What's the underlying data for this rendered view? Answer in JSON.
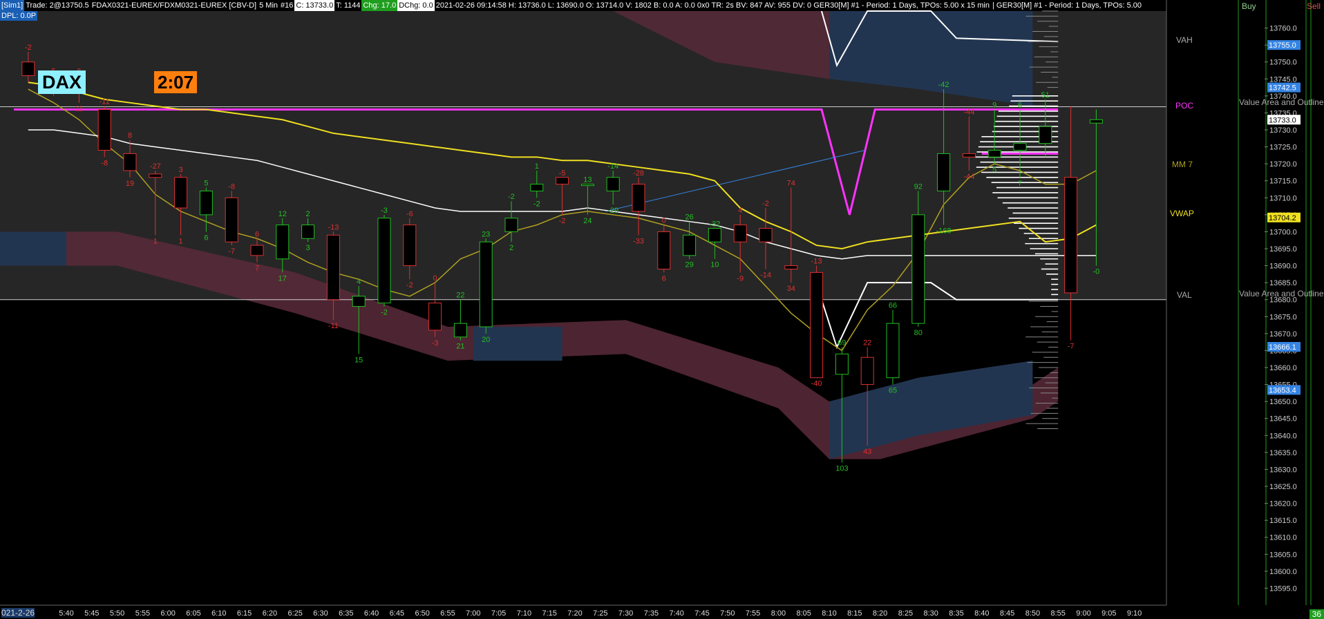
{
  "header": {
    "sim": "[Sim1]",
    "trade": "Trade: 2@13750.5",
    "instrument": "FDAX0321-EUREX/FDXM0321-EUREX [CBV-D]",
    "interval": "5 Min",
    "bar_no": "#16",
    "close": "C: 13733.0",
    "ticks": "T: 1144",
    "chg": "Chg: 17.0",
    "dchg": "DChg: 0.0",
    "stats": "2021-02-26 09:14:58 H: 13736.0 L: 13690.0 O: 13714.0 V: 1802 B: 0.0 A: 0.0 0x0 TR: 2s BV: 847 AV: 955 DV: 0 GER30[M] #1 - Period: 1 Days, TPOs: 5.00 x 15 min",
    "stats2": "| GER30[M] #1 - Period: 1 Days, TPOs: 5.00",
    "dpl": "DPL: 0.0P"
  },
  "labels": {
    "ticker": "DAX",
    "timer": "2:07",
    "vah": "VAH",
    "poc": "POC",
    "val": "VAL",
    "mm7": "MM 7",
    "vwap": "VWAP",
    "va_outline_1": "Value Area and Outline",
    "va_outline_2": "Value Area and Outline",
    "buy": "Buy",
    "sell": "Sell",
    "sell_count": "36",
    "date_label": "021-2-26"
  },
  "colors": {
    "up": "#22c022",
    "down": "#e03030",
    "poc": "#ff33ff",
    "vwap": "#f0e020",
    "white_line": "#ffffff",
    "olive_line": "#b0a020",
    "band_red": "#5a2a3a",
    "band_blue": "#223550"
  },
  "chart_data": {
    "type": "candlestick",
    "ylim": [
      13590,
      13765
    ],
    "y_ticks": [
      13595,
      13600,
      13605,
      13610,
      13615,
      13620,
      13625,
      13630,
      13635,
      13640,
      13645,
      13650,
      13655,
      13660,
      13665,
      13670,
      13675,
      13680,
      13685,
      13690,
      13695,
      13700,
      13705,
      13710,
      13715,
      13720,
      13725,
      13730,
      13735,
      13740,
      13745,
      13750,
      13755,
      13760
    ],
    "x_ticks": [
      "5:40",
      "5:45",
      "5:50",
      "5:55",
      "6:00",
      "6:05",
      "6:10",
      "6:15",
      "6:20",
      "6:25",
      "6:30",
      "6:35",
      "6:40",
      "6:45",
      "6:50",
      "6:55",
      "7:00",
      "7:05",
      "7:10",
      "7:15",
      "7:20",
      "7:25",
      "7:30",
      "7:35",
      "7:40",
      "7:45",
      "7:50",
      "7:55",
      "8:00",
      "8:05",
      "8:10",
      "8:15",
      "8:20",
      "8:25",
      "8:30",
      "8:35",
      "8:40",
      "8:45",
      "8:50",
      "8:55",
      "9:00",
      "9:05",
      "9:10"
    ],
    "price_tags": [
      {
        "value": 13755.0,
        "label": "13755.0",
        "bg": "#3584e4",
        "fg": "#fff"
      },
      {
        "value": 13742.5,
        "label": "13742.5",
        "bg": "#3584e4",
        "fg": "#fff"
      },
      {
        "value": 13733.0,
        "label": "13733.0",
        "bg": "#ffffff",
        "fg": "#000"
      },
      {
        "value": 13704.2,
        "label": "13704.2",
        "bg": "#f0e020",
        "fg": "#000"
      },
      {
        "value": 13666.1,
        "label": "13666.1",
        "bg": "#3584e4",
        "fg": "#fff"
      },
      {
        "value": 13653.4,
        "label": "13653.4",
        "bg": "#3584e4",
        "fg": "#fff"
      }
    ],
    "levels": {
      "vah": 13755,
      "poc": 13736,
      "val": 13680
    },
    "candles": [
      {
        "x": 0,
        "o": 13750,
        "c": 13746,
        "h": 13753,
        "l": 13744,
        "top": "-2",
        "bot": ""
      },
      {
        "x": 1,
        "o": 13745,
        "c": 13742,
        "h": 13746,
        "l": 13740,
        "top": "5",
        "bot": ""
      },
      {
        "x": 2,
        "o": 13744,
        "c": 13741,
        "h": 13746,
        "l": 13738,
        "top": "6",
        "bot": "11"
      },
      {
        "x": 3,
        "o": 13736,
        "c": 13724,
        "h": 13737,
        "l": 13722,
        "top": "-11",
        "bot": "-8"
      },
      {
        "x": 4,
        "o": 13723,
        "c": 13718,
        "h": 13727,
        "l": 13716,
        "top": "8",
        "bot": "19"
      },
      {
        "x": 5,
        "o": 13717,
        "c": 13716,
        "h": 13718,
        "l": 13699,
        "top": "-27",
        "bot": "1"
      },
      {
        "x": 6,
        "o": 13716,
        "c": 13707,
        "h": 13717,
        "l": 13699,
        "top": "3",
        "bot": "1"
      },
      {
        "x": 7,
        "o": 13705,
        "c": 13712,
        "h": 13713,
        "l": 13700,
        "top": "5",
        "bot": "6"
      },
      {
        "x": 8,
        "o": 13710,
        "c": 13697,
        "h": 13712,
        "l": 13696,
        "top": "-8",
        "bot": "-7"
      },
      {
        "x": 9,
        "o": 13696,
        "c": 13693,
        "h": 13698,
        "l": 13691,
        "top": "6",
        "bot": "7"
      },
      {
        "x": 10,
        "o": 13692,
        "c": 13702,
        "h": 13704,
        "l": 13688,
        "top": "12",
        "bot": "17"
      },
      {
        "x": 11,
        "o": 13698,
        "c": 13702,
        "h": 13704,
        "l": 13697,
        "top": "2",
        "bot": "3"
      },
      {
        "x": 12,
        "o": 13699,
        "c": 13680,
        "h": 13700,
        "l": 13674,
        "top": "-13",
        "bot": "-11"
      },
      {
        "x": 13,
        "o": 13678,
        "c": 13681,
        "h": 13684,
        "l": 13664,
        "top": "4",
        "bot": "15"
      },
      {
        "x": 14,
        "o": 13679,
        "c": 13704,
        "h": 13705,
        "l": 13678,
        "top": "-3",
        "bot": "-2"
      },
      {
        "x": 15,
        "o": 13702,
        "c": 13690,
        "h": 13704,
        "l": 13686,
        "top": "-6",
        "bot": "-2"
      },
      {
        "x": 16,
        "o": 13679,
        "c": 13671,
        "h": 13685,
        "l": 13669,
        "top": "0",
        "bot": "-3"
      },
      {
        "x": 17,
        "o": 13669,
        "c": 13673,
        "h": 13680,
        "l": 13668,
        "top": "22",
        "bot": "21"
      },
      {
        "x": 18,
        "o": 13672,
        "c": 13697,
        "h": 13698,
        "l": 13670,
        "top": "23",
        "bot": "20"
      },
      {
        "x": 19,
        "o": 13700,
        "c": 13704,
        "h": 13709,
        "l": 13697,
        "top": "-2",
        "bot": "2"
      },
      {
        "x": 20,
        "o": 13712,
        "c": 13714,
        "h": 13718,
        "l": 13710,
        "top": "1",
        "bot": "-2"
      },
      {
        "x": 21,
        "o": 13716,
        "c": 13714,
        "h": 13716,
        "l": 13705,
        "top": "-5",
        "bot": "-2"
      },
      {
        "x": 22,
        "o": 13714,
        "c": 13714,
        "h": 13714,
        "l": 13705,
        "top": "13",
        "bot": "24"
      },
      {
        "x": 23,
        "o": 13712,
        "c": 13716,
        "h": 13718,
        "l": 13708,
        "top": "-14",
        "bot": "-29"
      },
      {
        "x": 24,
        "o": 13714,
        "c": 13706,
        "h": 13716,
        "l": 13699,
        "top": "-28",
        "bot": "-33"
      },
      {
        "x": 25,
        "o": 13700,
        "c": 13689,
        "h": 13702,
        "l": 13688,
        "top": "0",
        "bot": "6"
      },
      {
        "x": 26,
        "o": 13693,
        "c": 13699,
        "h": 13703,
        "l": 13692,
        "top": "26",
        "bot": "29"
      },
      {
        "x": 27,
        "o": 13697,
        "c": 13701,
        "h": 13701,
        "l": 13692,
        "top": "-32",
        "bot": "10"
      },
      {
        "x": 28,
        "o": 13702,
        "c": 13697,
        "h": 13705,
        "l": 13688,
        "top": "4",
        "bot": "-9"
      },
      {
        "x": 29,
        "o": 13701,
        "c": 13697,
        "h": 13707,
        "l": 13689,
        "top": "-2",
        "bot": "-14"
      },
      {
        "x": 30,
        "o": 13690,
        "c": 13689,
        "h": 13713,
        "l": 13685,
        "top": "74",
        "bot": "34"
      },
      {
        "x": 31,
        "o": 13688,
        "c": 13657,
        "h": 13690,
        "l": 13657,
        "top": "-13",
        "bot": "-40"
      },
      {
        "x": 32,
        "o": 13658,
        "c": 13664,
        "h": 13666,
        "l": 13632,
        "top": "69",
        "bot": "103"
      },
      {
        "x": 33,
        "o": 13663,
        "c": 13655,
        "h": 13666,
        "l": 13637,
        "top": "22",
        "bot": "43"
      },
      {
        "x": 34,
        "o": 13657,
        "c": 13673,
        "h": 13677,
        "l": 13655,
        "top": "66",
        "bot": "65"
      },
      {
        "x": 35,
        "o": 13673,
        "c": 13705,
        "h": 13712,
        "l": 13672,
        "top": "92",
        "bot": "80"
      },
      {
        "x": 36,
        "o": 13712,
        "c": 13723,
        "h": 13742,
        "l": 13702,
        "top": "-42",
        "bot": "-168"
      },
      {
        "x": 37,
        "o": 13723,
        "c": 13722,
        "h": 13734,
        "l": 13718,
        "top": "-44",
        "bot": "-44"
      },
      {
        "x": 38,
        "o": 13722,
        "c": 13724,
        "h": 13736,
        "l": 13720,
        "top": "9",
        "bot": "5"
      },
      {
        "x": 39,
        "o": 13724,
        "c": 13726,
        "h": 13736,
        "l": 13716,
        "top": "6",
        "bot": "7"
      },
      {
        "x": 40,
        "o": 13726,
        "c": 13731,
        "h": 13739,
        "l": 13722,
        "top": "51",
        "bot": ""
      },
      {
        "x": 41,
        "o": 13716,
        "c": 13682,
        "h": 13737,
        "l": 13668,
        "top": "",
        "bot": "-7"
      },
      {
        "x": 42,
        "o": 13732,
        "c": 13733,
        "h": 13736,
        "l": 13690,
        "top": "",
        "bot": "-0"
      }
    ],
    "series": [
      {
        "name": "MM 7",
        "color": "#b0a020",
        "values": [
          13742,
          13738,
          13733,
          13726,
          13720,
          13711,
          13706,
          13703,
          13700,
          13698,
          13695,
          13691,
          13688,
          13686,
          13683,
          13681,
          13685,
          13692,
          13695,
          13700,
          13702,
          13705,
          13706,
          13705,
          13704,
          13702,
          13700,
          13696,
          13692,
          13684,
          13676,
          13670,
          13665,
          13677,
          13684,
          13694,
          13708,
          13716,
          13720,
          13718,
          13714,
          13714,
          13718
        ]
      },
      {
        "name": "VWAP",
        "color": "#f0e020",
        "values": [
          13744,
          13743,
          13741,
          13739,
          13738,
          13737,
          13736,
          13736,
          13735,
          13734,
          13733,
          13731,
          13729,
          13728,
          13727,
          13726,
          13725,
          13724,
          13723,
          13722,
          13722,
          13721,
          13721,
          13720,
          13719,
          13718,
          13717,
          13715,
          13707,
          13703,
          13700,
          13696,
          13695,
          13697,
          13698,
          13699,
          13700,
          13701,
          13702,
          13703,
          13697,
          13698,
          13702
        ]
      },
      {
        "name": "White",
        "color": "#ffffff",
        "values": [
          13730,
          13730,
          13729,
          13728,
          13726,
          13725,
          13724,
          13723,
          13722,
          13721,
          13719,
          13717,
          13715,
          13713,
          13711,
          13709,
          13707,
          13706,
          13706,
          13706,
          13706,
          13706,
          13707,
          13706,
          13705,
          13704,
          13703,
          13702,
          13700,
          13697,
          13695,
          13693,
          13692,
          13693,
          13693,
          13693,
          13693,
          13693,
          13693,
          13693,
          13693,
          13693,
          13693
        ]
      }
    ]
  }
}
